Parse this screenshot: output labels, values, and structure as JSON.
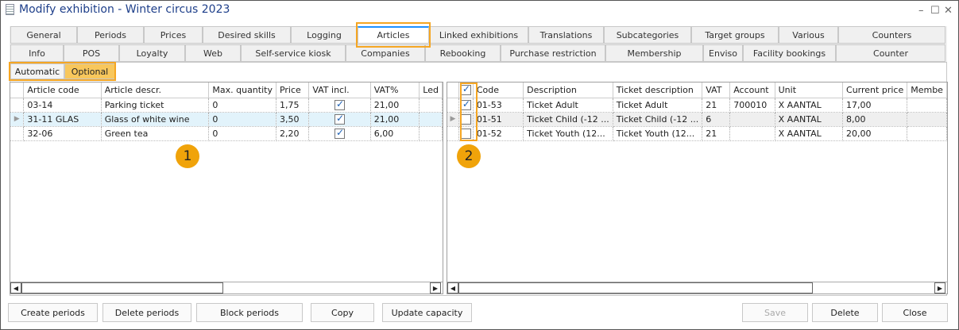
{
  "window": {
    "title": "Modify exhibition - Winter circus 2023",
    "minimize": "–",
    "maximize": "☐",
    "close": "✕"
  },
  "tabs_row1": [
    "General",
    "Periods",
    "Prices",
    "Desired skills",
    "Logging",
    "Articles",
    "Linked exhibitions",
    "Translations",
    "Subcategories",
    "Target groups",
    "Various",
    "Counters"
  ],
  "tabs_row2": [
    "Info",
    "POS",
    "Loyalty",
    "Web",
    "Self-service kiosk",
    "Companies",
    "Rebooking",
    "Purchase restriction",
    "Membership",
    "Enviso",
    "Facility bookings",
    "Counter"
  ],
  "active_tab": "Articles",
  "subtabs": [
    "Automatic",
    "Optional"
  ],
  "active_subtab": "Optional",
  "left_grid": {
    "columns": [
      "Article code",
      "Article descr.",
      "Max. quantity",
      "Price",
      "VAT incl.",
      "VAT%",
      "Led"
    ],
    "rows": [
      {
        "code": "03-14",
        "descr": "Parking ticket",
        "max": "0",
        "price": "1,75",
        "vat_incl": true,
        "vat": "21,00"
      },
      {
        "code": "31-11 GLAS",
        "descr": "Glass of white wine",
        "max": "0",
        "price": "3,50",
        "vat_incl": true,
        "vat": "21,00",
        "selected": true
      },
      {
        "code": "32-06",
        "descr": "Green tea",
        "max": "0",
        "price": "2,20",
        "vat_incl": true,
        "vat": "6,00"
      }
    ]
  },
  "right_grid": {
    "header_checked": true,
    "columns": [
      "Code",
      "Description",
      "Ticket description",
      "VAT",
      "Account",
      "Unit",
      "Current price",
      "Membe"
    ],
    "rows": [
      {
        "checked": true,
        "code": "01-53",
        "descr": "Ticket Adult",
        "ticket": "Ticket Adult",
        "vat": "21",
        "account": "700010",
        "unit": "X AANTAL",
        "price": "17,00"
      },
      {
        "checked": false,
        "code": "01-51",
        "descr": "Ticket Child (-12 ...",
        "ticket": "Ticket Child (-12 ...",
        "vat": "6",
        "account": "",
        "unit": "X AANTAL",
        "price": "8,00",
        "selected": true
      },
      {
        "checked": false,
        "code": "01-52",
        "descr": "Ticket Youth (12...",
        "ticket": "Ticket Youth (12...",
        "vat": "21",
        "account": "",
        "unit": "X AANTAL",
        "price": "20,00"
      }
    ]
  },
  "badges": [
    "1",
    "2"
  ],
  "buttons_left": [
    "Create periods",
    "Delete periods",
    "Block periods",
    "Copy",
    "Update capacity"
  ],
  "buttons_right": [
    "Save",
    "Delete",
    "Close"
  ],
  "colors": {
    "highlight": "#f5a623",
    "badge": "#f0a30a",
    "title": "#1e3f8a"
  }
}
